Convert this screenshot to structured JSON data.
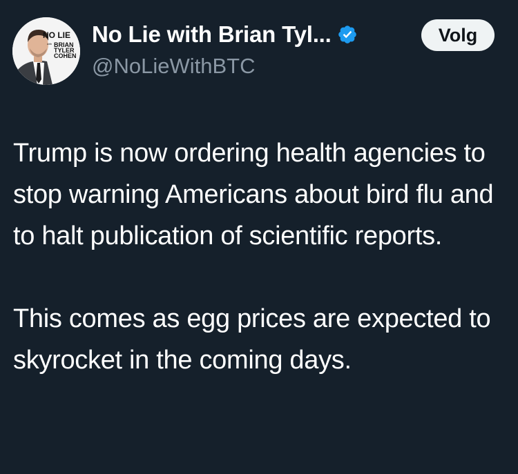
{
  "author": {
    "display_name": "No Lie with Brian Tyl...",
    "handle": "@NoLieWithBTC",
    "verified": true,
    "avatar_logo": {
      "line1": "NO LIE",
      "line2": "with",
      "line3": "BRIAN",
      "line4": "TYLER",
      "line5": "COHEN"
    }
  },
  "follow_button": {
    "label": "Volg"
  },
  "tweet": {
    "paragraphs": [
      "Trump is now ordering health agencies to stop warning Americans about bird flu and to halt publication of scientific reports.",
      "This comes as egg prices are expected to skyrocket in the coming days."
    ]
  },
  "colors": {
    "background": "#15202b",
    "text_primary": "#ffffff",
    "text_secondary": "#8b98a5",
    "verified_badge": "#1d9bf0",
    "follow_button_bg": "#eff3f4",
    "follow_button_text": "#0f1419"
  },
  "icons": {
    "verified": "verified-badge-icon"
  }
}
